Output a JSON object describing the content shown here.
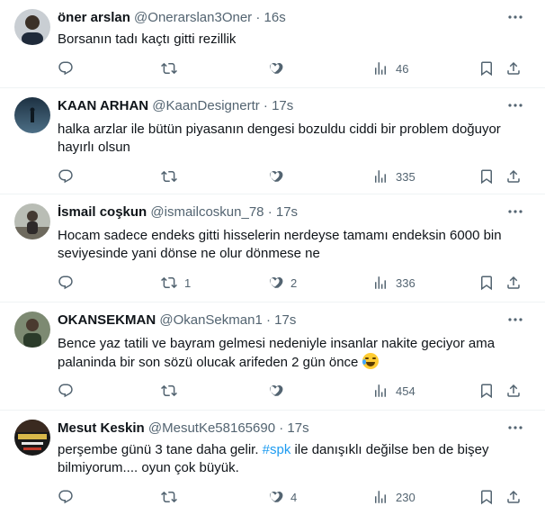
{
  "tweets": [
    {
      "name": "öner arslan",
      "handle": "@Onerarslan3Oner",
      "time": "16s",
      "text": "Borsanın tadı kaçtı gitti rezillik",
      "replies": "",
      "retweets": "",
      "likes": "",
      "views": "46"
    },
    {
      "name": "KAAN ARHAN",
      "handle": "@KaanDesignertr",
      "time": "17s",
      "text": "halka arzlar ile bütün piyasanın dengesi bozuldu ciddi bir problem doğuyor hayırlı olsun",
      "replies": "",
      "retweets": "",
      "likes": "",
      "views": "335"
    },
    {
      "name": "İsmail coşkun",
      "handle": "@ismailcoskun_78",
      "time": "17s",
      "text": "Hocam sadece endeks gitti hisselerin nerdeyse tamamı endeksin 6000 bin seviyesinde yani dönse ne olur dönmese ne",
      "replies": "",
      "retweets": "1",
      "likes": "2",
      "views": "336"
    },
    {
      "name": "OKANSEKMAN",
      "handle": "@OkanSekman1",
      "time": "17s",
      "text": "Bence yaz tatili ve bayram gelmesi nedeniyle insanlar nakite geciyor ama palaninda bir son sözü olucak arifeden 2 gün önce",
      "replies": "",
      "retweets": "",
      "likes": "",
      "views": "454"
    },
    {
      "name": "Mesut Keskin",
      "handle": "@MesutKe58165690",
      "time": "17s",
      "text_before": "perşembe günü 3 tane daha gelir. ",
      "hashtag": "#spk",
      "text_after": " ile danışıklı değilse ben de bişey bilmiyorum.... oyun çok büyük.",
      "replies": "",
      "retweets": "",
      "likes": "4",
      "views": "230"
    }
  ],
  "dot": "·",
  "icons": [
    "reply-icon",
    "retweet-icon",
    "like-icon",
    "views-icon",
    "bookmark-icon",
    "share-icon",
    "more-icon"
  ],
  "colors": {
    "text": "#0f1419",
    "muted": "#536471",
    "link": "#1d9bf0",
    "divider": "#eff3f4"
  }
}
